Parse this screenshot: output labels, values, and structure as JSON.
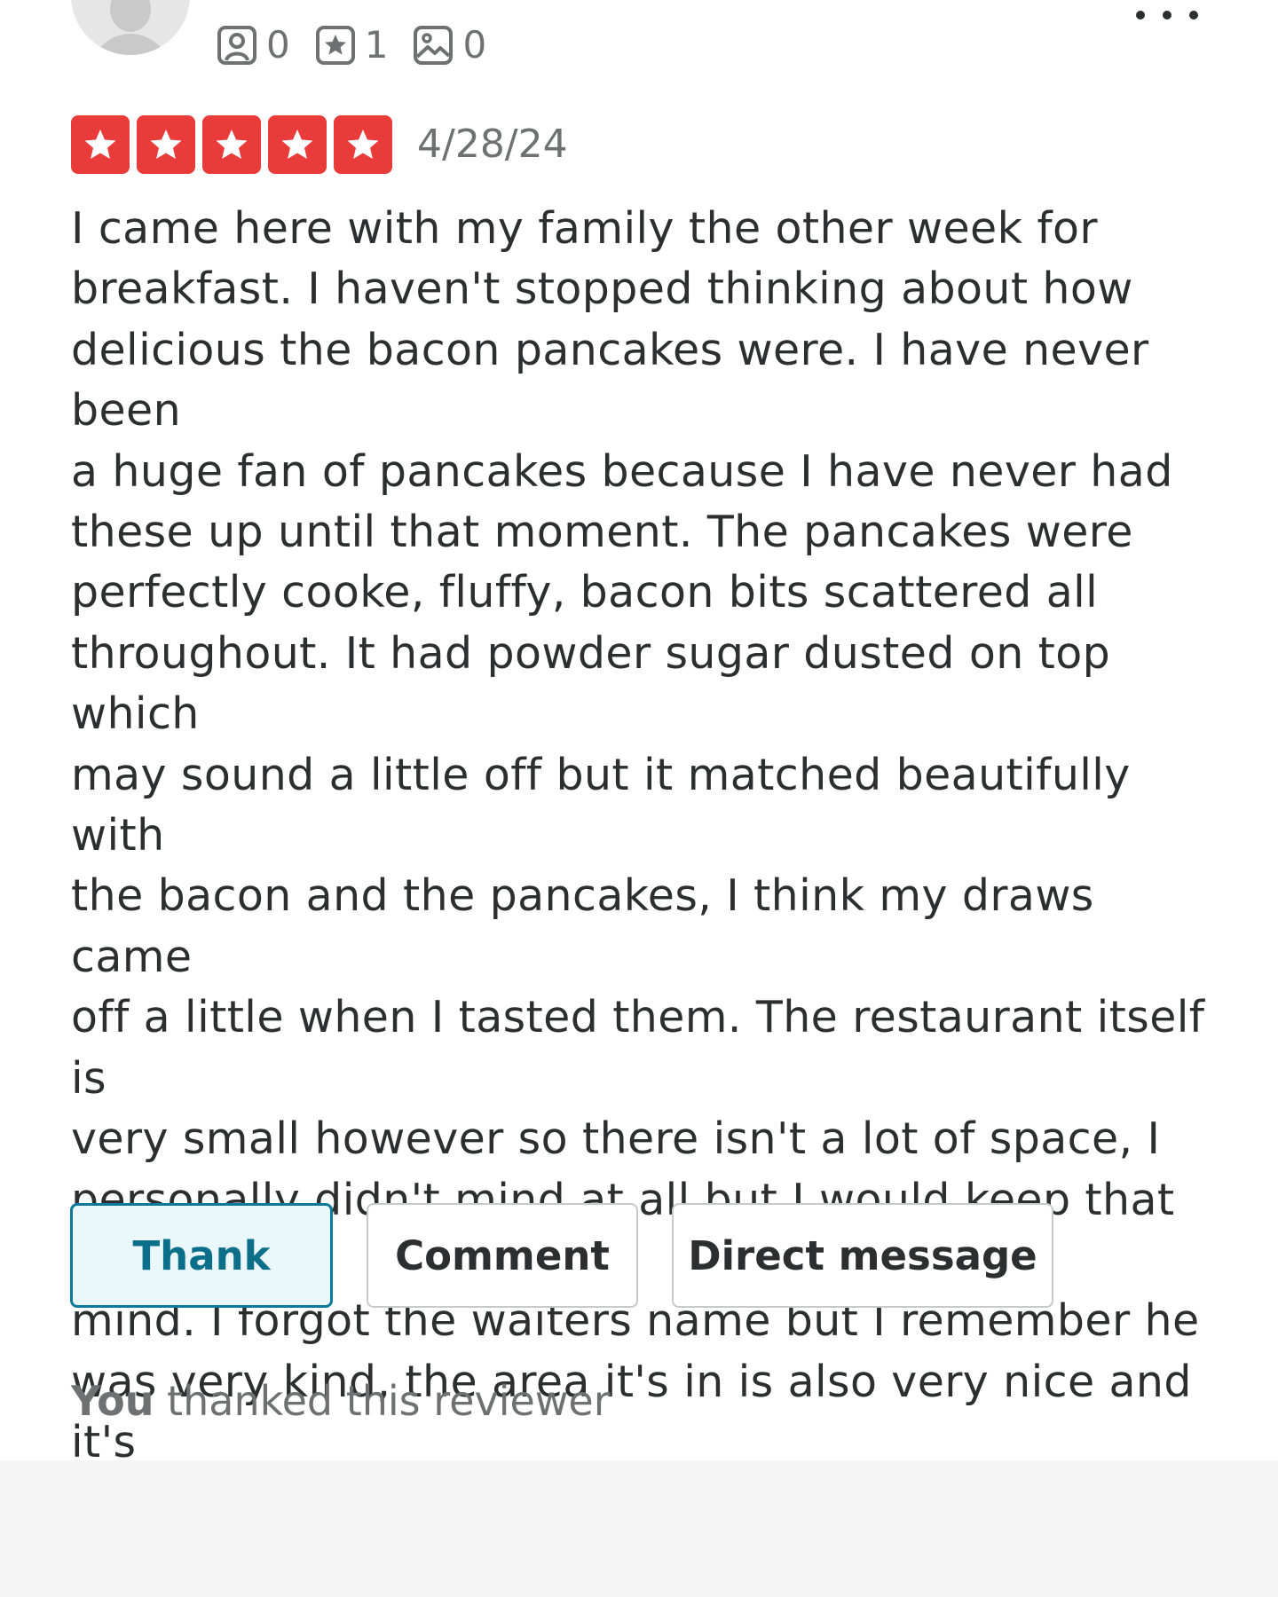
{
  "reviewer": {
    "avatar_icon": "user-silhouette-icon",
    "stats": [
      {
        "icon": "friends-icon",
        "value": "0"
      },
      {
        "icon": "reviews-star-icon",
        "value": "1"
      },
      {
        "icon": "photos-icon",
        "value": "0"
      }
    ],
    "more_menu_icon": "more-dots-icon"
  },
  "review": {
    "rating": 5,
    "max_rating": 5,
    "star_color": "#ea3b3b",
    "date": "4/28/24",
    "text": "I came here with my family the other week for\nbreakfast. I haven't stopped thinking about how\ndelicious the bacon pancakes were. I have never been\na huge fan of pancakes because I have never had\nthese up until that moment. The pancakes were\nperfectly cooke, fluffy, bacon bits scattered all\nthroughout. It had powder sugar dusted on top which\nmay sound a little off but it matched beautifully with\nthe bacon and the pancakes, I think my draws came\noff a little when I tasted them. The restaurant itself is\nvery small however so there isn't a lot of space, I\npersonally didn't mind at all but I would keep that in\nmind. I forgot the waiters name but I remember he\nwas very kind, the area it's in is also very nice and it's\nnear the outlets if you want to do some shopping\nafter. Overall Great experience no Tony the Tiger."
  },
  "actions": {
    "thank_label": "Thank",
    "comment_label": "Comment",
    "dm_label": "Direct message",
    "thank_active": true,
    "thank_color": "#0b7a9a"
  },
  "status": {
    "you": "You",
    "message": " thanked this reviewer"
  }
}
